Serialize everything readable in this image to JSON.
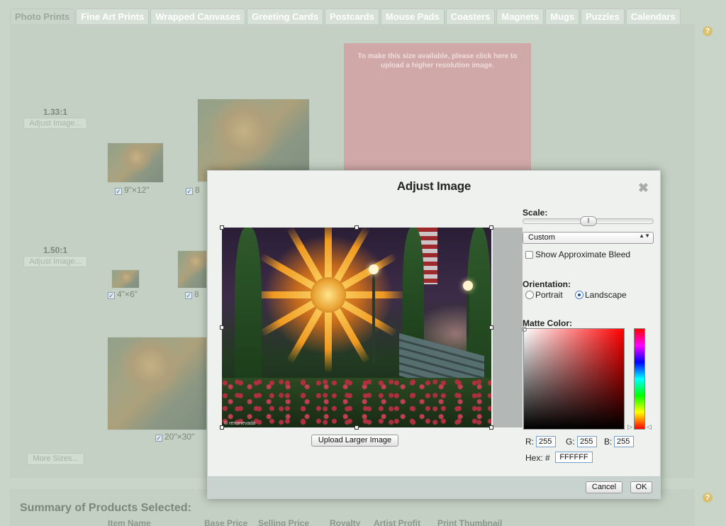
{
  "tabs": [
    "Photo Prints",
    "Fine Art Prints",
    "Wrapped Canvases",
    "Greeting Cards",
    "Postcards",
    "Mouse Pads",
    "Coasters",
    "Magnets",
    "Mugs",
    "Puzzles",
    "Calendars"
  ],
  "help_glyph": "?",
  "background": {
    "ratio_1": {
      "label": "1.33:1",
      "adjust": "Adjust Image..."
    },
    "ratio_2": {
      "label": "1.50:1",
      "adjust": "Adjust Image..."
    },
    "sizes": {
      "s9x12": "9\"×12\"",
      "s8": "8",
      "s4x6": "4\"×6\"",
      "s8b": "8",
      "s20x30": "20\"×30\""
    },
    "unavailable_message": "To make this size available, please click here to upload a higher resolution image.",
    "more_sizes": "More Sizes..."
  },
  "summary": {
    "title": "Summary of Products Selected:",
    "columns": [
      "Item Name",
      "Base Price",
      "Selling Price",
      "Royalty",
      "Artist Profit",
      "Print Thumbnail"
    ]
  },
  "modal": {
    "title": "Adjust Image",
    "close_glyph": "✖",
    "photo_credit": "© renonevada",
    "upload_button": "Upload Larger Image",
    "scale_label": "Scale:",
    "scale_value": 0.5,
    "slider_grip": "|||",
    "scale_select": "Custom",
    "select_arrows": "▲▼",
    "bleed_label": "Show Approximate Bleed",
    "bleed_checked": false,
    "orientation_label": "Orientation:",
    "portrait_label": "Portrait",
    "landscape_label": "Landscape",
    "orientation_selected": "Landscape",
    "matte_label": "Matte Color:",
    "r_label": "R:",
    "r_value": "255",
    "g_label": "G:",
    "g_value": "255",
    "b_label": "B:",
    "b_value": "255",
    "hex_label": "Hex: #",
    "hex_value": "FFFFFF",
    "hue_marks": [
      "▷",
      "◁"
    ],
    "cancel_button": "Cancel",
    "ok_button": "OK"
  },
  "colors": {
    "page_bg": "#c8d5c8",
    "unavailable_box": "#d0a8a8",
    "modal_bg": "#eff1ef",
    "modal_footer": "#c8d2cf",
    "help_icon": "#d8c070"
  }
}
